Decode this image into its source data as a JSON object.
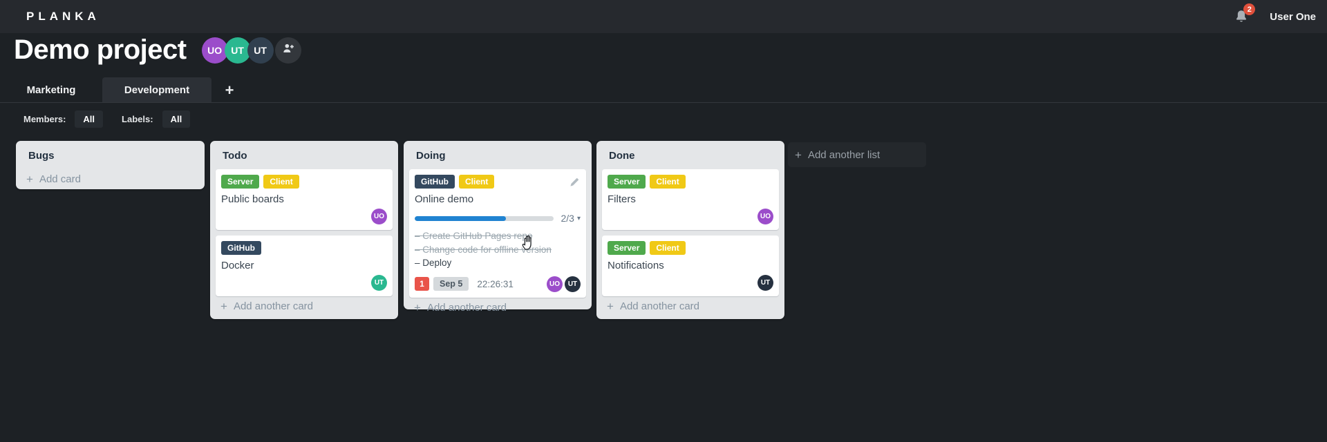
{
  "topbar": {
    "logo": "PLANKA",
    "notification_count": "2",
    "user_name": "User One"
  },
  "project": {
    "title": "Demo project",
    "members": [
      {
        "initials": "UO",
        "color": "#9b4dca"
      },
      {
        "initials": "UT",
        "color": "#2ab890"
      },
      {
        "initials": "UT",
        "color": "#31404f"
      }
    ]
  },
  "tabs": {
    "items": [
      {
        "label": "Marketing",
        "active": false
      },
      {
        "label": "Development",
        "active": true
      }
    ],
    "add_label": "+"
  },
  "filters": {
    "members_label": "Members:",
    "members_value": "All",
    "labels_label": "Labels:",
    "labels_value": "All"
  },
  "glyphs": {
    "plus": "+",
    "caret_down": "▾",
    "task_bullet": "–"
  },
  "board": {
    "add_list_label": "Add another list",
    "lists": [
      {
        "title": "Bugs",
        "add_card_label": "Add card",
        "cards": []
      },
      {
        "title": "Todo",
        "add_card_label": "Add another card",
        "cards": [
          {
            "name": "Public boards",
            "labels": [
              {
                "text": "Server",
                "color": "#4fa94c"
              },
              {
                "text": "Client",
                "color": "#f0c916"
              }
            ],
            "members": [
              {
                "initials": "UO",
                "color": "#9b4dca"
              }
            ]
          },
          {
            "name": "Docker",
            "labels": [
              {
                "text": "GitHub",
                "color": "#34495f"
              }
            ],
            "members": [
              {
                "initials": "UT",
                "color": "#2ab890"
              }
            ]
          }
        ]
      },
      {
        "title": "Doing",
        "add_card_label": "Add another card",
        "cards": [
          {
            "name": "Online demo",
            "labels": [
              {
                "text": "GitHub",
                "color": "#34495f"
              },
              {
                "text": "Client",
                "color": "#f0c916"
              }
            ],
            "progress": {
              "done": 2,
              "total": 3,
              "display": "2/3",
              "percent": "66%",
              "fill_color": "#2083d1"
            },
            "tasks": [
              {
                "text": "Create GitHub Pages repo",
                "completed": true
              },
              {
                "text": "Change code for offline version",
                "completed": true
              },
              {
                "text": "Deploy",
                "completed": false
              }
            ],
            "notification_count": "1",
            "notification_color": "#e9544a",
            "due_date": "Sep 5",
            "stopwatch": "22:26:31",
            "members": [
              {
                "initials": "UO",
                "color": "#9b4dca"
              },
              {
                "initials": "UT",
                "color": "#263140"
              }
            ]
          }
        ]
      },
      {
        "title": "Done",
        "add_card_label": "Add another card",
        "cards": [
          {
            "name": "Filters",
            "labels": [
              {
                "text": "Server",
                "color": "#4fa94c"
              },
              {
                "text": "Client",
                "color": "#f0c916"
              }
            ],
            "members": [
              {
                "initials": "UO",
                "color": "#9b4dca"
              }
            ]
          },
          {
            "name": "Notifications",
            "labels": [
              {
                "text": "Server",
                "color": "#4fa94c"
              },
              {
                "text": "Client",
                "color": "#f0c916"
              }
            ],
            "members": [
              {
                "initials": "UT",
                "color": "#263140"
              }
            ]
          }
        ]
      }
    ]
  }
}
